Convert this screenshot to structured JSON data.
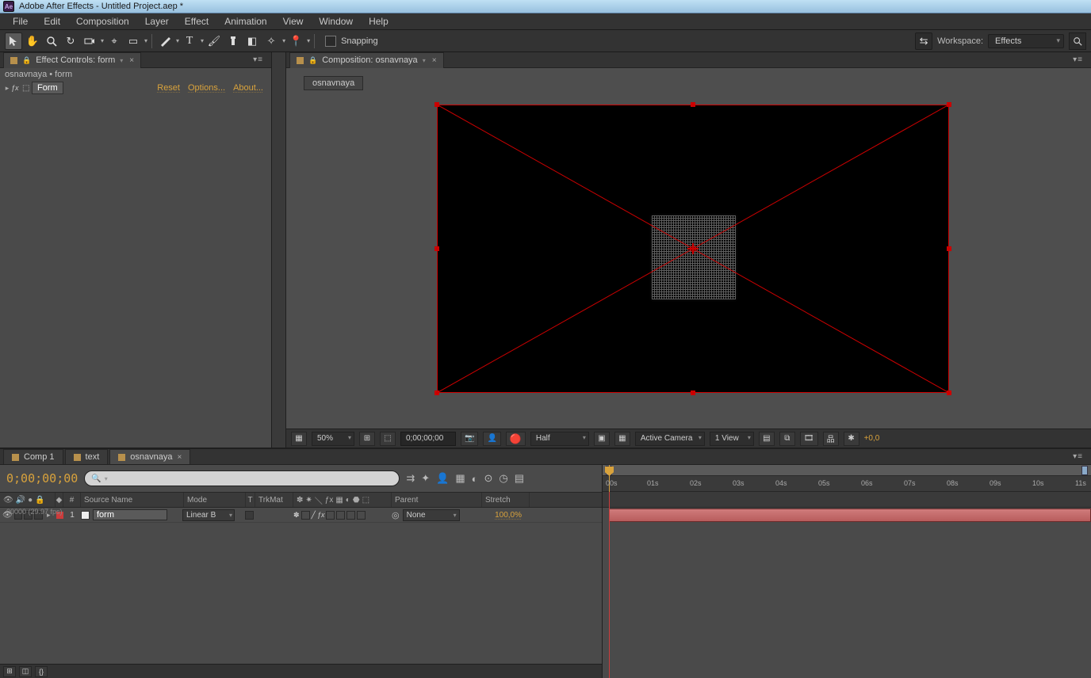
{
  "titlebar": {
    "app": "Ae",
    "title": "Adobe After Effects - Untitled Project.aep *"
  },
  "menu": [
    "File",
    "Edit",
    "Composition",
    "Layer",
    "Effect",
    "Animation",
    "View",
    "Window",
    "Help"
  ],
  "toolbar": {
    "snapping_label": "Snapping",
    "workspace_label": "Workspace:",
    "workspace_value": "Effects"
  },
  "effect_controls": {
    "panel_title": "Effect Controls: form",
    "path": "osnavnaya • form",
    "effect_name": "Form",
    "links": {
      "reset": "Reset",
      "options": "Options...",
      "about": "About..."
    }
  },
  "composition": {
    "panel_title": "Composition: osnavnaya",
    "tab": "osnavnaya"
  },
  "viewer_footer": {
    "zoom": "50%",
    "time": "0;00;00;00",
    "resolution": "Half",
    "camera": "Active Camera",
    "views": "1 View",
    "exposure": "+0,0"
  },
  "timeline": {
    "tabs": [
      {
        "label": "Comp 1",
        "active": false
      },
      {
        "label": "text",
        "active": false
      },
      {
        "label": "osnavnaya",
        "active": true
      }
    ],
    "timecode": "0;00;00;00",
    "framerate": "00000 (29.97 fps)",
    "search_placeholder": "",
    "columns": {
      "num": "#",
      "source": "Source Name",
      "mode": "Mode",
      "t": "T",
      "trk": "TrkMat",
      "parent": "Parent",
      "stretch": "Stretch"
    },
    "layer": {
      "index": "1",
      "name": "form",
      "mode": "Linear B",
      "parent": "None",
      "stretch": "100,0%"
    },
    "ruler_marks": [
      "00s",
      "01s",
      "02s",
      "03s",
      "04s",
      "05s",
      "06s",
      "07s",
      "08s",
      "09s",
      "10s",
      "11s"
    ]
  }
}
